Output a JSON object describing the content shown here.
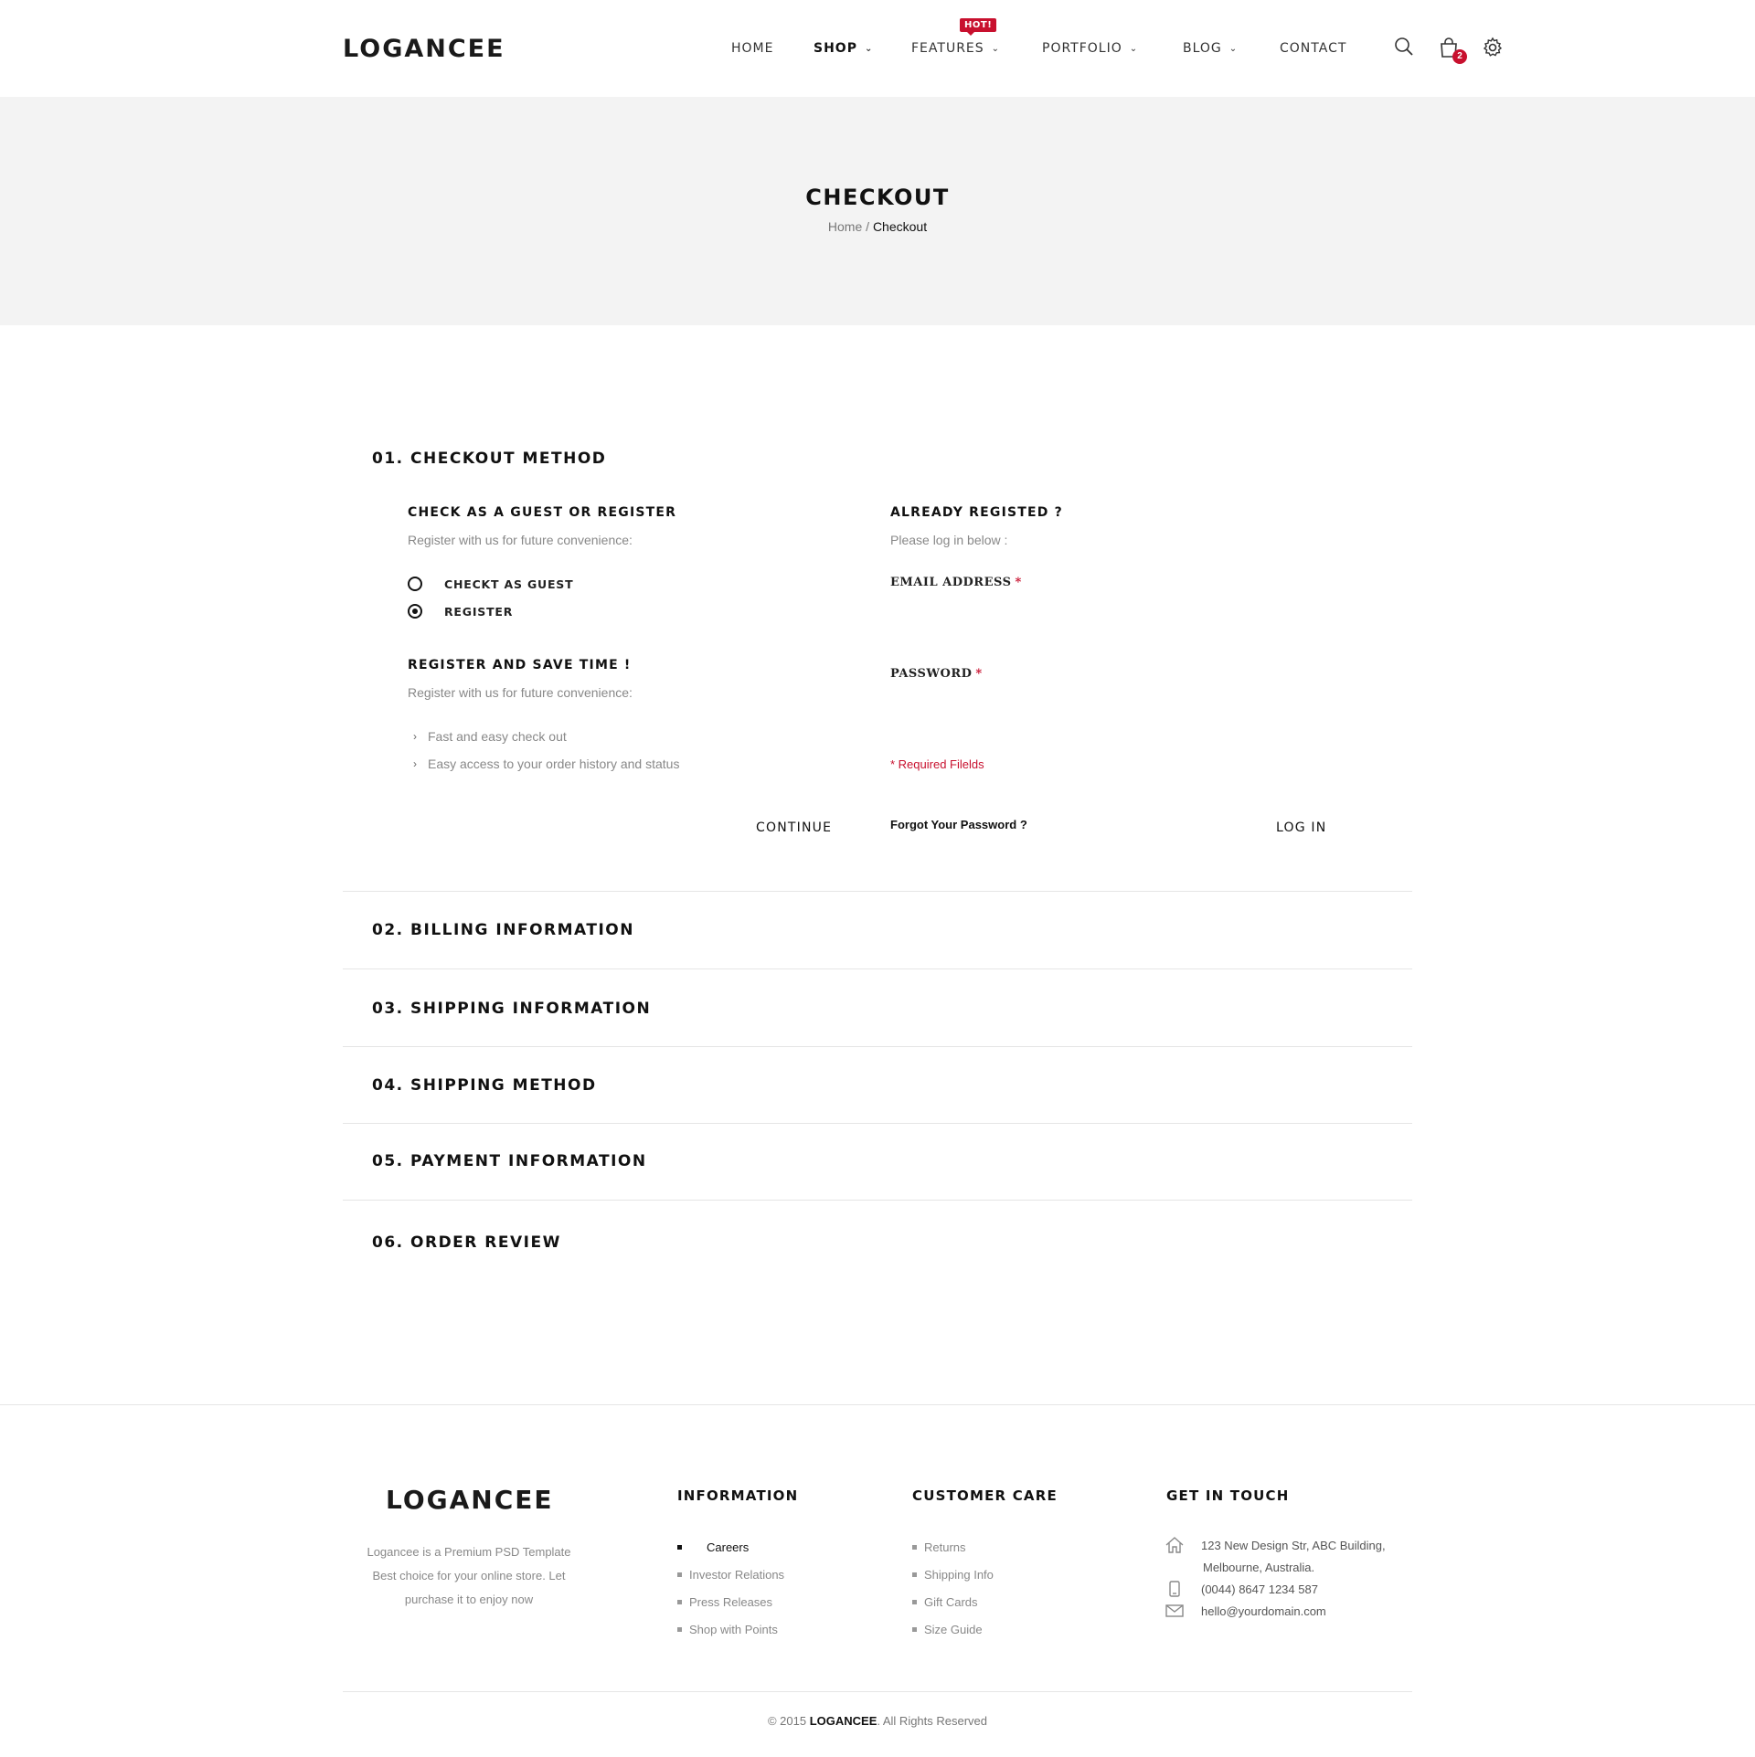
{
  "header": {
    "logo": "LOGANCEE",
    "nav": [
      {
        "label": "HOME",
        "active": false,
        "dropdown": false
      },
      {
        "label": "SHOP",
        "active": true,
        "dropdown": true
      },
      {
        "label": "FEATURES",
        "active": false,
        "dropdown": true,
        "badge": "HOT!"
      },
      {
        "label": "PORTFOLIO",
        "active": false,
        "dropdown": true
      },
      {
        "label": "BLOG",
        "active": false,
        "dropdown": true
      },
      {
        "label": "CONTACT",
        "active": false,
        "dropdown": false
      }
    ],
    "icons": [
      "search-icon",
      "cart-icon",
      "settings-icon"
    ],
    "cart_count": "2"
  },
  "title_band": {
    "title": "CHECKOUT",
    "breadcrumb_home": "Home",
    "breadcrumb_sep": " / ",
    "breadcrumb_current": "Checkout"
  },
  "checkout_method": {
    "title": "01. CHECKOUT METHOD",
    "guest_heading": "CHECK AS A GUEST OR REGISTER",
    "guest_sub": "Register with us for future convenience:",
    "options": [
      {
        "label": "CHECKT AS GUEST",
        "selected": false
      },
      {
        "label": "REGISTER",
        "selected": true
      }
    ],
    "register_heading": "REGISTER AND SAVE TIME !",
    "register_sub": "Register with us for future convenience:",
    "benefits": [
      "Fast and easy check out",
      "Easy access to your order history and status"
    ],
    "continue_label": "CONTINUE",
    "login_heading": "ALREADY REGISTED ?",
    "login_sub": "Please log in below :",
    "email_label": "EMAIL ADDRESS",
    "password_label": "PASSWORD",
    "required_mark": "*",
    "required_note": "* Required Filelds",
    "forgot_label": "Forgot Your Password ?",
    "login_label": "LOG IN"
  },
  "sections": [
    "02. BILLING INFORMATION",
    "03. SHIPPING INFORMATION",
    "04. SHIPPING METHOD",
    "05. PAYMENT INFORMATION",
    "06. ORDER REVIEW"
  ],
  "footer": {
    "logo": "LOGANCEE",
    "about": "Logancee is a Premium PSD Template Best choice for your online store. Let purchase it to enjoy now",
    "information": {
      "title": "INFORMATION",
      "items": [
        "Careers",
        "Investor Relations",
        "Press Releases",
        "Shop with Points"
      ]
    },
    "customer_care": {
      "title": "CUSTOMER CARE",
      "items": [
        "Returns",
        "Shipping Info",
        "Gift Cards",
        "Size Guide"
      ]
    },
    "contact": {
      "title": "GET IN TOUCH",
      "address_line1": "123 New Design Str, ABC Building,",
      "address_line2": "Melbourne, Australia.",
      "phone": "(0044) 8647 1234 587",
      "email": "hello@yourdomain.com"
    },
    "copyright_prefix": "© 2015 ",
    "copyright_brand": "LOGANCEE",
    "copyright_suffix": ". All Rights Reserved"
  },
  "colors": {
    "accent": "#c8102e",
    "band": "#f3f3f3",
    "text": "#111111",
    "muted": "#888888"
  }
}
